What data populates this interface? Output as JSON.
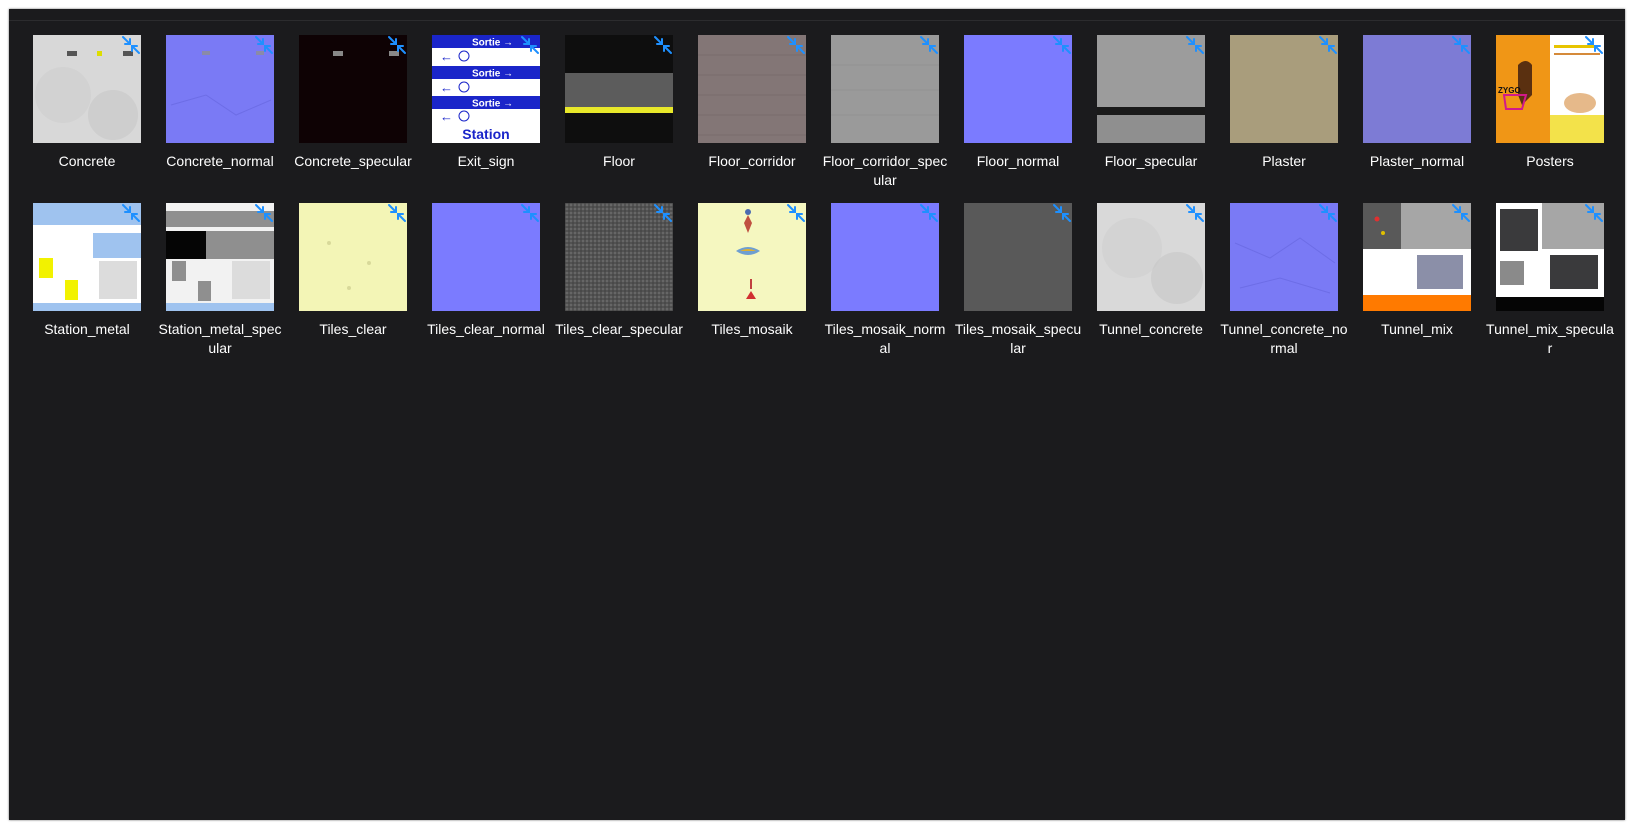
{
  "files": [
    {
      "name": "Concrete",
      "thumb": "concrete"
    },
    {
      "name": "Concrete_normal",
      "thumb": "concrete-normal"
    },
    {
      "name": "Concrete_specular",
      "thumb": "concrete-specular"
    },
    {
      "name": "Exit_sign",
      "thumb": "exit-sign"
    },
    {
      "name": "Floor",
      "thumb": "floor"
    },
    {
      "name": "Floor_corridor",
      "thumb": "floor-corridor"
    },
    {
      "name": "Floor_corridor_specular",
      "thumb": "floor-corridor-specular"
    },
    {
      "name": "Floor_normal",
      "thumb": "floor-normal"
    },
    {
      "name": "Floor_specular",
      "thumb": "floor-specular"
    },
    {
      "name": "Plaster",
      "thumb": "plaster"
    },
    {
      "name": "Plaster_normal",
      "thumb": "plaster-normal"
    },
    {
      "name": "Posters",
      "thumb": "posters"
    },
    {
      "name": "Station_metal",
      "thumb": "station-metal"
    },
    {
      "name": "Station_metal_specular",
      "thumb": "station-metal-specular"
    },
    {
      "name": "Tiles_clear",
      "thumb": "tiles-clear"
    },
    {
      "name": "Tiles_clear_normal",
      "thumb": "tiles-clear-normal"
    },
    {
      "name": "Tiles_clear_specular",
      "thumb": "tiles-clear-specular"
    },
    {
      "name": "Tiles_mosaik",
      "thumb": "tiles-mosaik"
    },
    {
      "name": "Tiles_mosaik_normal",
      "thumb": "tiles-mosaik-normal"
    },
    {
      "name": "Tiles_mosaik_specular",
      "thumb": "tiles-mosaik-specular"
    },
    {
      "name": "Tunnel_concrete",
      "thumb": "tunnel-concrete"
    },
    {
      "name": "Tunnel_concrete_normal",
      "thumb": "tunnel-concrete-normal"
    },
    {
      "name": "Tunnel_mix",
      "thumb": "tunnel-mix"
    },
    {
      "name": "Tunnel_mix_specular",
      "thumb": "tunnel-mix-specular"
    }
  ],
  "exit_sign": {
    "sortie": "Sortie",
    "station": "Station"
  },
  "posters": {
    "brand": "ZYGO"
  },
  "colors": {
    "window_bg": "#1b1b1d",
    "label_text": "#ffffff",
    "badge_blue": "#1e90ff",
    "normal_map": "#7b7bff"
  },
  "badge_icon": "compressed-arrows-icon"
}
